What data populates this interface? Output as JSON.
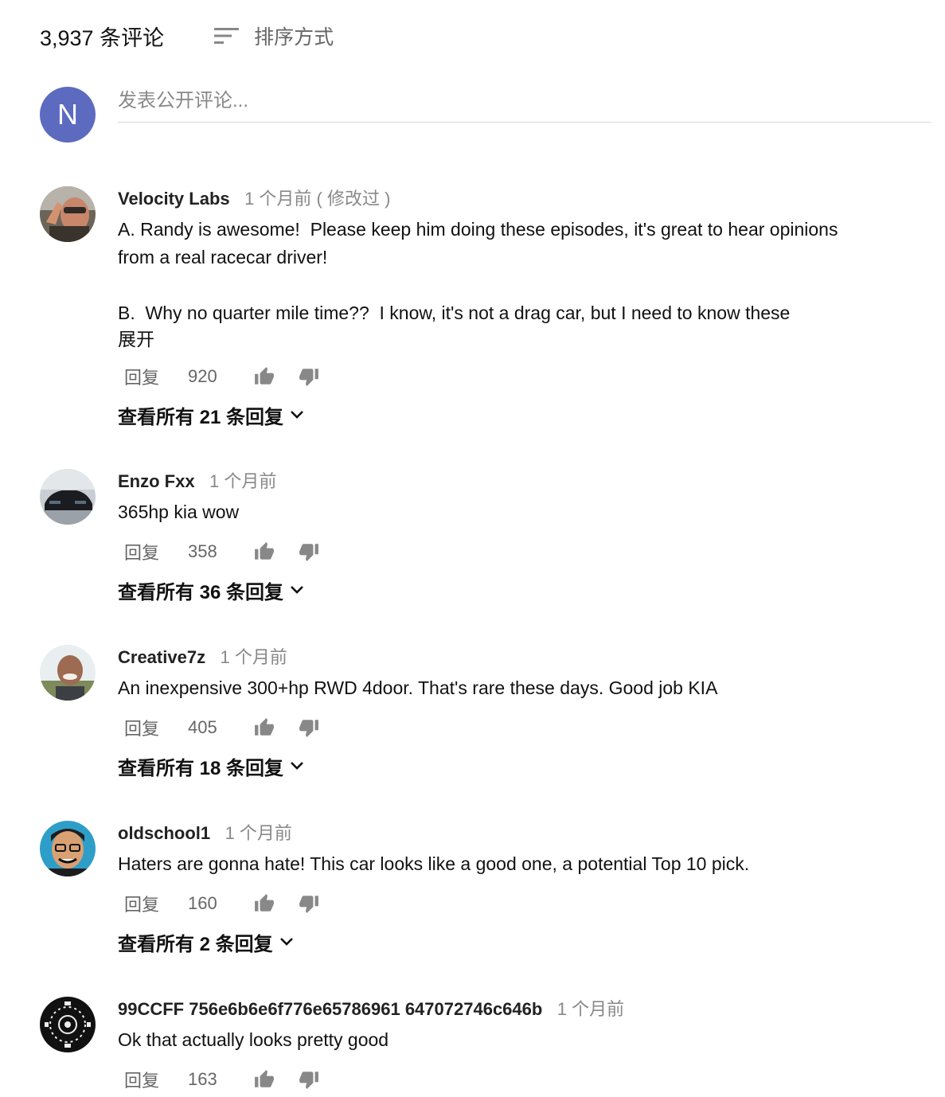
{
  "header": {
    "comment_count": "3,937 条评论",
    "sort_label": "排序方式"
  },
  "composer": {
    "avatar_letter": "N",
    "placeholder": "发表公开评论...",
    "avatar_color": "#5c6bc0"
  },
  "comments": [
    {
      "author": "Velocity Labs",
      "time": "1 个月前 ( 修改过 )",
      "text": "A. Randy is awesome!  Please keep him doing these episodes, it's great to hear opinions\nfrom a real racecar driver!\n\nB.  Why no quarter mile time??  I know, it's not a drag car, but I need to know these",
      "expand": "展开",
      "reply": "回复",
      "likes": "920",
      "view_replies": "查看所有 21 条回复"
    },
    {
      "author": "Enzo Fxx",
      "time": "1 个月前",
      "text": "365hp kia wow",
      "reply": "回复",
      "likes": "358",
      "view_replies": "查看所有 36 条回复"
    },
    {
      "author": "Creative7z",
      "time": "1 个月前",
      "text": "An inexpensive 300+hp RWD 4door. That's rare these days. Good job KIA",
      "reply": "回复",
      "likes": "405",
      "view_replies": "查看所有 18 条回复"
    },
    {
      "author": "oldschool1",
      "time": "1 个月前",
      "text": "Haters are gonna hate! This car looks like a good one, a potential Top 10 pick.",
      "reply": "回复",
      "likes": "160",
      "view_replies": "查看所有 2 条回复"
    },
    {
      "author": "99CCFF 756e6b6e6f776e65786961 647072746c646b",
      "time": "1 个月前",
      "text": "Ok that actually looks pretty good",
      "reply": "回复",
      "likes": "163"
    }
  ],
  "icons": {
    "sort": "sort-icon",
    "like": "thumb-up-icon",
    "dislike": "thumb-down-icon",
    "chevron": "chevron-down-icon"
  }
}
